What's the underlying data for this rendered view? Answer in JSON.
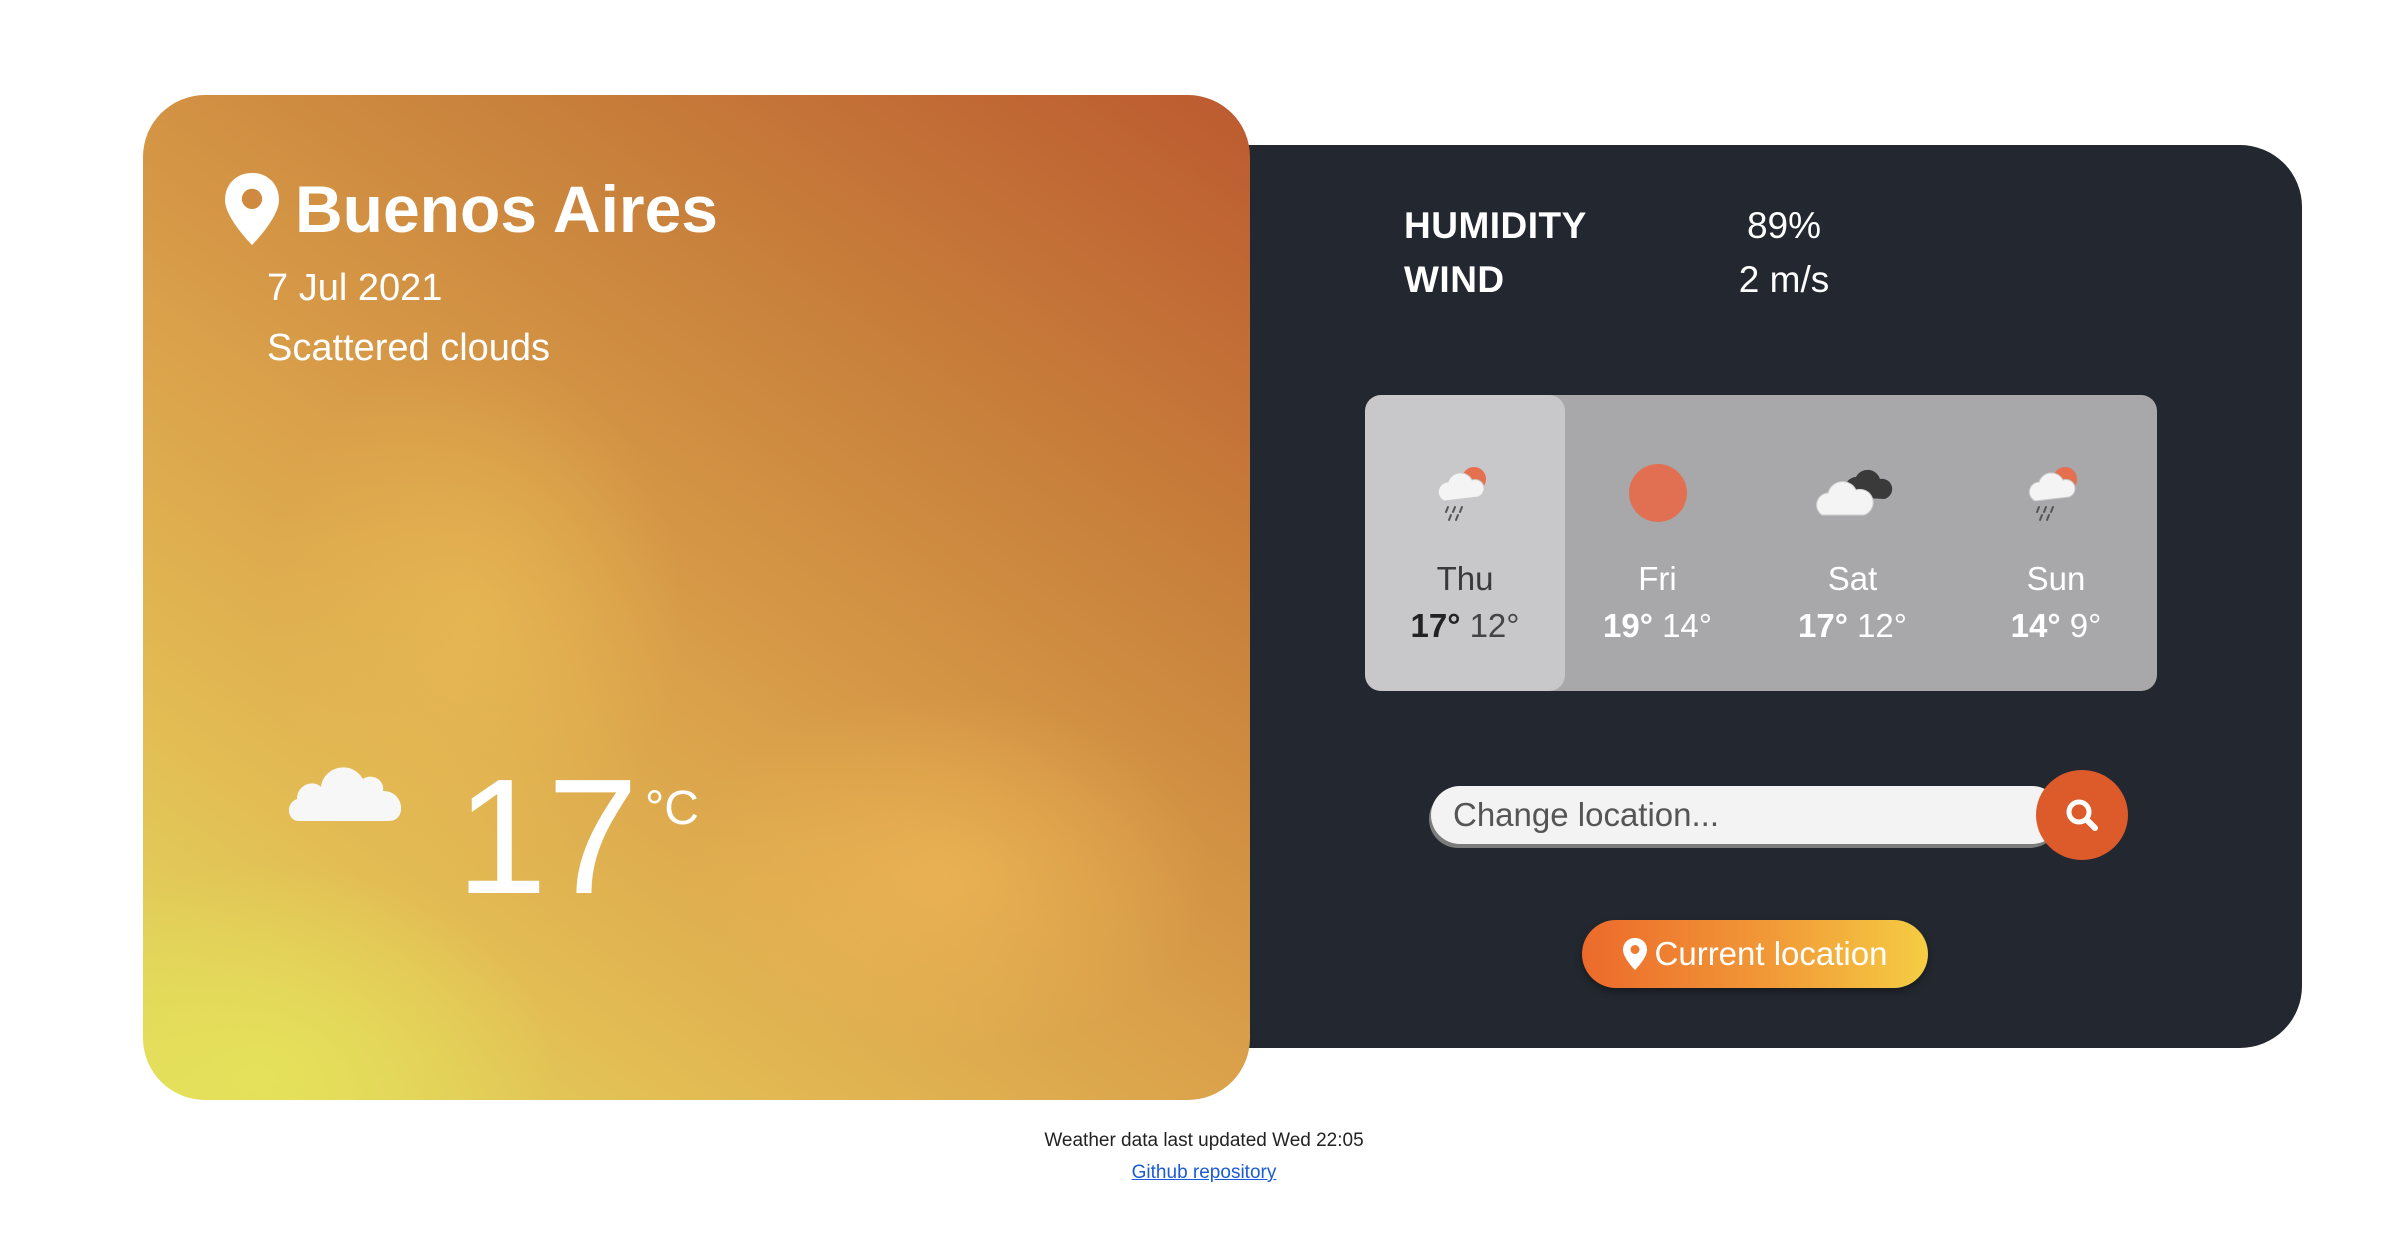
{
  "location": {
    "city": "Buenos Aires",
    "date": "7 Jul 2021",
    "description": "Scattered clouds",
    "temperature": "17",
    "unit": "°C",
    "icon": "cloud-icon"
  },
  "stats": {
    "humidity_label": "HUMIDITY",
    "humidity_value": "89%",
    "wind_label": "WIND",
    "wind_value": "2 m/s"
  },
  "forecast": [
    {
      "day": "Thu",
      "high": "17°",
      "low": "12°",
      "icon": "cloud-rain-sun-icon",
      "selected": true
    },
    {
      "day": "Fri",
      "high": "19°",
      "low": "14°",
      "icon": "sun-icon",
      "selected": false
    },
    {
      "day": "Sat",
      "high": "17°",
      "low": "12°",
      "icon": "cloudy-icon",
      "selected": false
    },
    {
      "day": "Sun",
      "high": "14°",
      "low": "9°",
      "icon": "cloud-rain-sun-icon",
      "selected": false
    }
  ],
  "search": {
    "placeholder": "Change location...",
    "button_icon": "search-icon"
  },
  "current_location": {
    "label": "Current location",
    "icon": "map-pin-icon"
  },
  "footer": {
    "updated_text": "Weather data last updated Wed 22:05",
    "link_text": "Github repository"
  },
  "colors": {
    "panel_bg": "#232830",
    "accent_orange": "#dd5a2a",
    "forecast_bg": "#a8a8aa",
    "forecast_selected_bg": "#c8c7c9",
    "link_blue": "#1a5bd6"
  }
}
